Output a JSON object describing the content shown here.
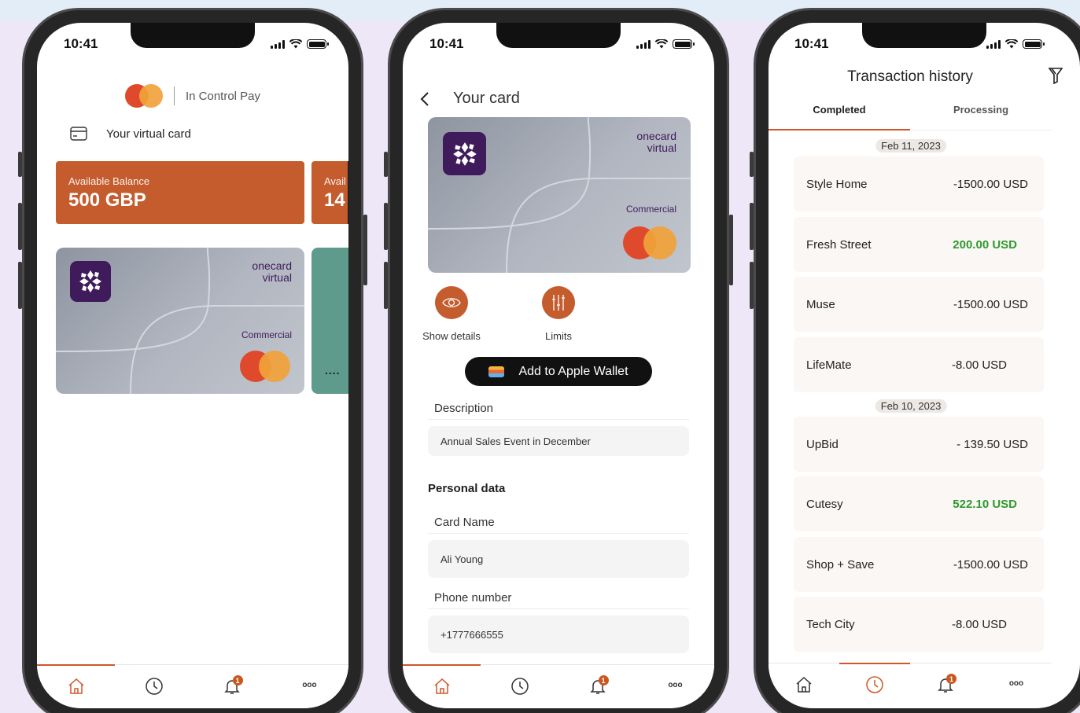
{
  "status": {
    "time": "10:41"
  },
  "screen1": {
    "brand": "In Control Pay",
    "section_title": "Your virtual card",
    "balance_label": "Available Balance",
    "balance_value": "500 GBP",
    "balance2_label": "Avail",
    "balance2_value": "14",
    "card": {
      "line1": "onecard",
      "line2": "virtual",
      "type": "Commercial"
    },
    "more_dots": "...."
  },
  "screen2": {
    "title": "Your card",
    "card": {
      "line1": "onecard",
      "line2": "virtual",
      "type": "Commercial"
    },
    "actions": [
      {
        "label": "Show details",
        "icon": "eye-icon"
      },
      {
        "label": "Limits",
        "icon": "sliders-icon"
      }
    ],
    "wallet_button": "Add to Apple Wallet",
    "description_label": "Description",
    "description_value": "Annual Sales Event in December",
    "personal_section": "Personal data",
    "card_name_label": "Card Name",
    "card_name_value": "Ali Young",
    "phone_label": "Phone number",
    "phone_value": "+1777666555"
  },
  "screen3": {
    "title": "Transaction history",
    "tabs": [
      "Completed",
      "Processing"
    ],
    "groups": [
      {
        "date": "Feb 11, 2023",
        "items": [
          {
            "name": "Style Home",
            "amount": "-1500.00 USD",
            "positive": false
          },
          {
            "name": "Fresh Street",
            "amount": "200.00 USD",
            "positive": true
          },
          {
            "name": "Muse",
            "amount": "-1500.00 USD",
            "positive": false
          },
          {
            "name": "LifeMate",
            "amount": "-8.00 USD",
            "positive": false
          }
        ]
      },
      {
        "date": "Feb 10, 2023",
        "items": [
          {
            "name": "UpBid",
            "amount": "- 139.50 USD",
            "positive": false
          },
          {
            "name": "Cutesy",
            "amount": "522.10 USD",
            "positive": true
          },
          {
            "name": "Shop + Save",
            "amount": "-1500.00 USD",
            "positive": false
          },
          {
            "name": "Tech City",
            "amount": "-8.00 USD",
            "positive": false
          }
        ]
      }
    ]
  },
  "tabbar": {
    "items": [
      "home-icon",
      "clock-icon",
      "bell-icon",
      "more-icon"
    ],
    "badge": "1",
    "more_glyph": "ooo"
  },
  "colors": {
    "accent": "#c45c2e",
    "brand_purple": "#3f1b5c",
    "positive": "#2d9a2d",
    "mc_red": "#e04a2c",
    "mc_orange": "#f0a23a"
  }
}
